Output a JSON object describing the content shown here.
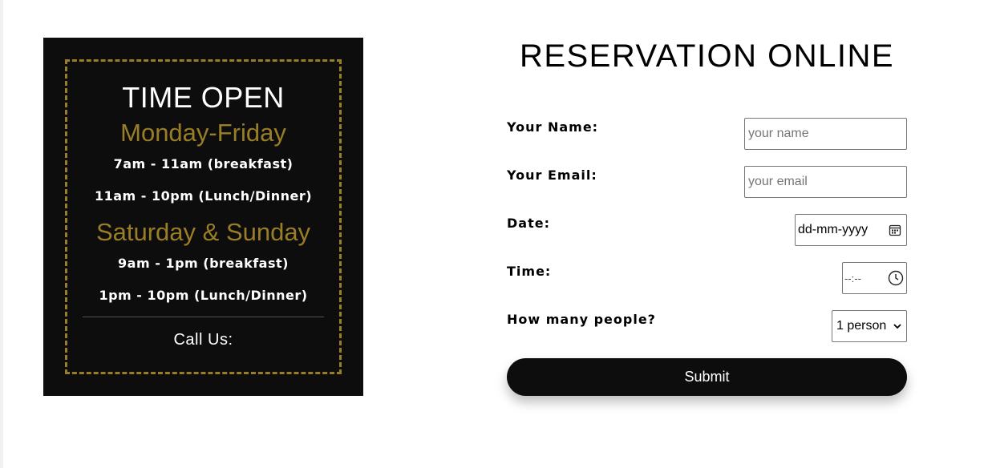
{
  "hours": {
    "title": "TIME OPEN",
    "weekday": {
      "heading": "Monday-Friday",
      "slots": [
        "7am - 11am (breakfast)",
        "11am - 10pm (Lunch/Dinner)"
      ]
    },
    "weekend": {
      "heading": "Saturday & Sunday",
      "slots": [
        "9am - 1pm (breakfast)",
        "1pm - 10pm (Lunch/Dinner)"
      ]
    },
    "call_us": "Call Us:"
  },
  "reservation": {
    "title": "RESERVATION ONLINE",
    "fields": {
      "name": {
        "label": "Your Name:",
        "placeholder": "your name"
      },
      "email": {
        "label": "Your Email:",
        "placeholder": "your email"
      },
      "date": {
        "label": "Date:",
        "value": "dd-mm-yyyy",
        "icon": "calendar-icon"
      },
      "time": {
        "label": "Time:",
        "value": "--:--",
        "icon": "clock-icon"
      },
      "people": {
        "label": "How many people?",
        "selected": "1 person",
        "icon": "chevron-down-icon"
      }
    },
    "submit_label": "Submit"
  },
  "colors": {
    "panel_bg": "#0d0d0d",
    "gold_accent": "#9a7d27",
    "button_bg": "#0d0d0d",
    "text": "#000000"
  }
}
